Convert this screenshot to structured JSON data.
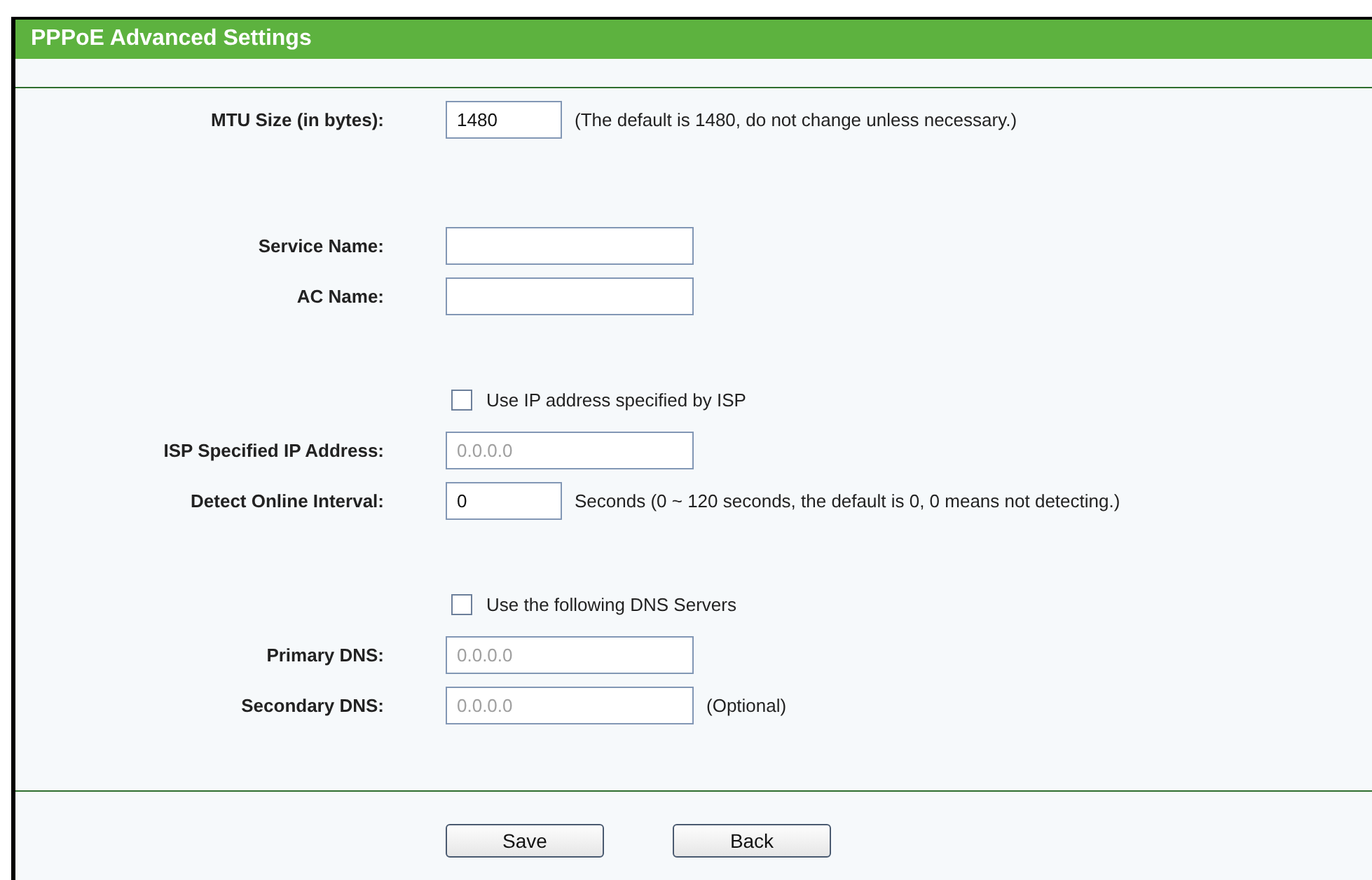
{
  "title": "PPPoE Advanced Settings",
  "sections": [
    {
      "rows": [
        {
          "kind": "short-field",
          "label": "MTU Size (in bytes):",
          "value": "1480",
          "disabled": false,
          "note": "(The default is 1480, do not change unless necessary.)"
        }
      ]
    },
    {
      "rows": [
        {
          "kind": "field",
          "label": "Service Name:"
        },
        {
          "kind": "field",
          "label": "AC Name:"
        }
      ]
    },
    {
      "rows": [
        {
          "kind": "checkbox",
          "label": "Use IP address specified by ISP",
          "checked": false
        },
        {
          "kind": "field",
          "label": "ISP Specified IP Address:",
          "value": "0.0.0.0",
          "disabled": true
        },
        {
          "kind": "short-field",
          "label": "Detect Online Interval:",
          "value": "0",
          "disabled": false,
          "note": "Seconds (0 ~ 120 seconds, the default is 0, 0 means not detecting.)"
        }
      ]
    },
    {
      "rows": [
        {
          "kind": "checkbox",
          "label": "Use the following DNS Servers",
          "checked": false
        },
        {
          "kind": "field",
          "label": "Primary DNS:",
          "value": "0.0.0.0",
          "disabled": true
        },
        {
          "kind": "field",
          "label": "Secondary DNS:",
          "value": "0.0.0.0",
          "disabled": true,
          "note": "(Optional)"
        }
      ]
    }
  ],
  "buttons": [
    "Save",
    "Back"
  ]
}
